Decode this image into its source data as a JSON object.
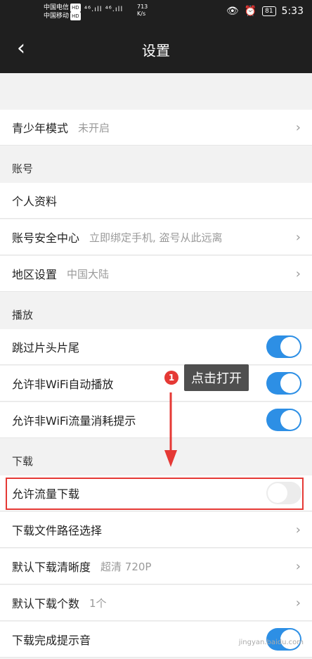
{
  "status_bar": {
    "carrier1": "中国电信",
    "carrier2": "中国移动",
    "hd": "HD",
    "signal": "⁴⁶.ıll ⁴⁶.ıll",
    "speed_value": "713",
    "speed_unit": "K/s",
    "battery": "81",
    "time": "5:33",
    "icons": [
      "eye-icon",
      "alarm-icon",
      "wifi-icon",
      "battery-icon"
    ]
  },
  "header": {
    "title": "设置",
    "back_icon": "‹"
  },
  "rows": {
    "youth_mode": {
      "label": "青少年模式",
      "value": "未开启"
    },
    "account_section": "账号",
    "profile": {
      "label": "个人资料"
    },
    "security": {
      "label": "账号安全中心",
      "value": "立即绑定手机, 盗号从此远离"
    },
    "region": {
      "label": "地区设置",
      "value": "中国大陆"
    },
    "play_section": "播放",
    "skip_intro": {
      "label": "跳过片头片尾",
      "enabled": true
    },
    "non_wifi_autoplay": {
      "label": "允许非WiFi自动播放",
      "enabled": true
    },
    "non_wifi_tip": {
      "label": "允许非WiFi流量消耗提示",
      "enabled": true
    },
    "download_section": "下载",
    "allow_data_download": {
      "label": "允许流量下载",
      "enabled": false
    },
    "download_path": {
      "label": "下载文件路径选择"
    },
    "default_quality": {
      "label": "默认下载清晰度",
      "value": "超清 720P"
    },
    "default_count": {
      "label": "默认下载个数",
      "value": "1个"
    },
    "download_sound": {
      "label": "下载完成提示音",
      "enabled": true
    }
  },
  "annotation": {
    "step": "1",
    "tip": "点击打开",
    "highlight_color": "#e53935"
  },
  "colors": {
    "accent": "#2d8fe5",
    "header_bg": "#1f1f1f",
    "highlight": "#e53935"
  },
  "watermark": "jingyan.baidu.com"
}
